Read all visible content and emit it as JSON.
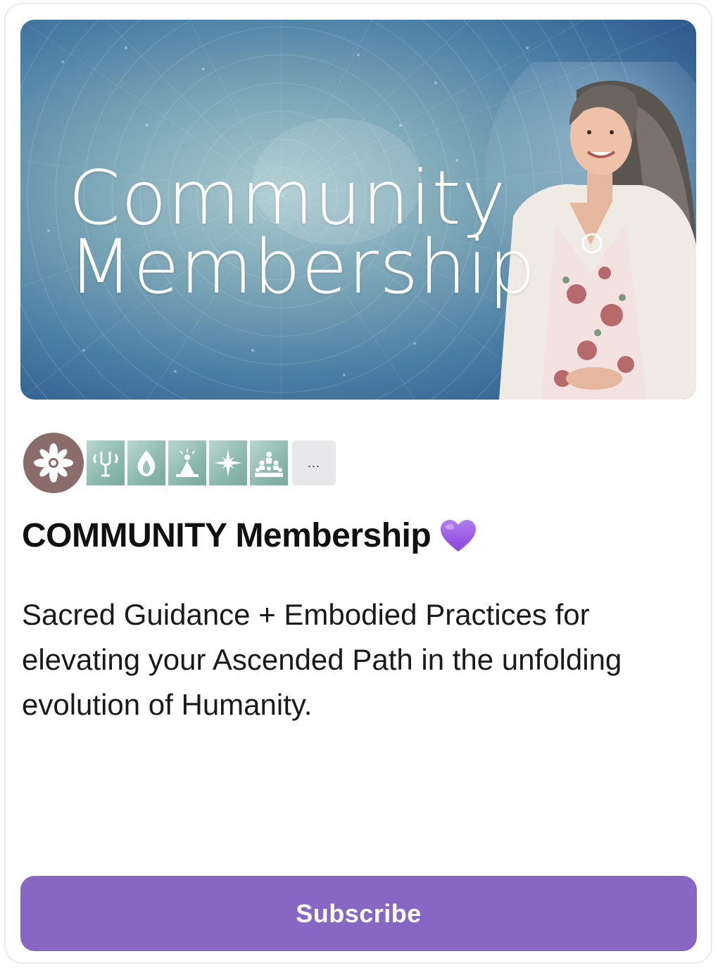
{
  "banner": {
    "title_line1": "Community",
    "title_line2": "Membership"
  },
  "product": {
    "title": "COMMUNITY Membership",
    "description": "Sacred Guidance + Embodied Practices for elevating your Ascended Path in the unfolding evolution of Humanity."
  },
  "icons": [
    {
      "name": "lotus-mandala-icon"
    },
    {
      "name": "tuning-fork-icon"
    },
    {
      "name": "flame-icon"
    },
    {
      "name": "meditating-figure-icon"
    },
    {
      "name": "star-burst-icon"
    },
    {
      "name": "group-people-icon"
    }
  ],
  "more_label": "...",
  "actions": {
    "subscribe_label": "Subscribe"
  },
  "colors": {
    "accent": "#8866c4",
    "heart": "#9b5de5"
  }
}
